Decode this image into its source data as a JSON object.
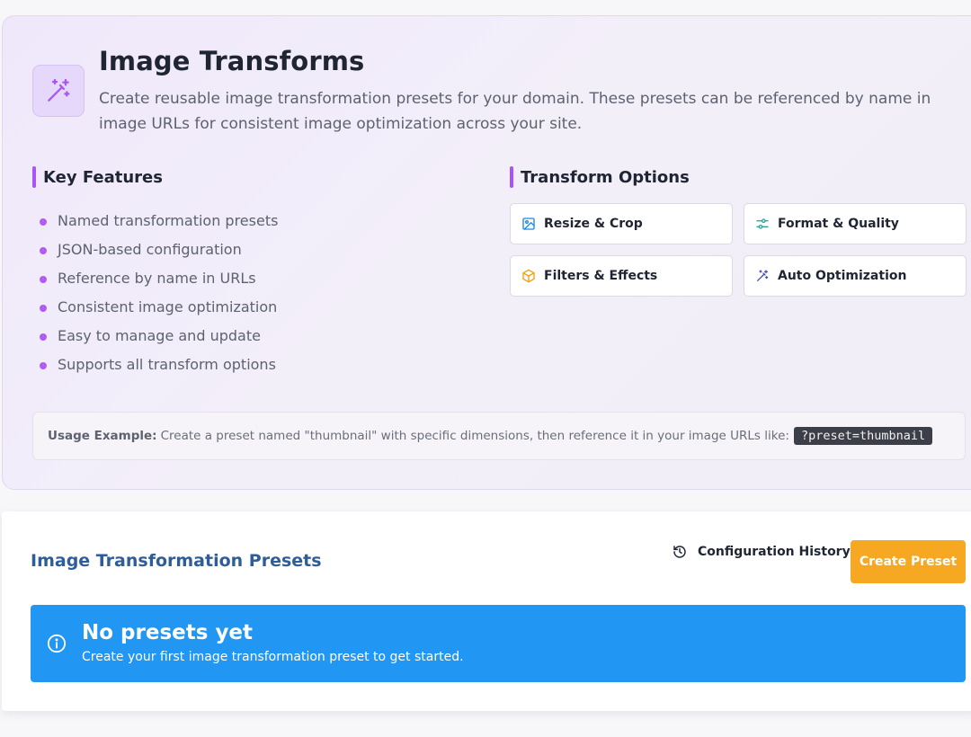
{
  "hero": {
    "icon": "magic-wand-icon",
    "title": "Image Transforms",
    "description": "Create reusable image transformation presets for your domain. These presets can be referenced by name in image URLs for consistent image optimization across your site."
  },
  "key_features": {
    "heading": "Key Features",
    "items": [
      "Named transformation presets",
      "JSON-based configuration",
      "Reference by name in URLs",
      "Consistent image optimization",
      "Easy to manage and update",
      "Supports all transform options"
    ]
  },
  "transform_options": {
    "heading": "Transform Options",
    "options": [
      {
        "label": "Resize & Crop",
        "icon": "image-icon",
        "color": "#1e88e5"
      },
      {
        "label": "Format & Quality",
        "icon": "sliders-icon",
        "color": "#26a69a"
      },
      {
        "label": "Filters & Effects",
        "icon": "cube-icon",
        "color": "#f59e0b"
      },
      {
        "label": "Auto Optimization",
        "icon": "magic-wand-icon",
        "color": "#3f51b5"
      }
    ]
  },
  "usage": {
    "label": "Usage Example:",
    "text": "Create a preset named \"thumbnail\" with specific dimensions, then reference it in your image URLs like:",
    "code": "?preset=thumbnail"
  },
  "presets_panel": {
    "title": "Image Transformation Presets",
    "history_button": "Configuration History",
    "create_button": "Create Preset",
    "empty_title": "No presets yet",
    "empty_text": "Create your first image transformation preset to get started."
  },
  "colors": {
    "accent_purple": "#a855f7",
    "panel_title": "#2f5d9a",
    "create_button": "#f7a823",
    "notice": "#2196f3"
  }
}
